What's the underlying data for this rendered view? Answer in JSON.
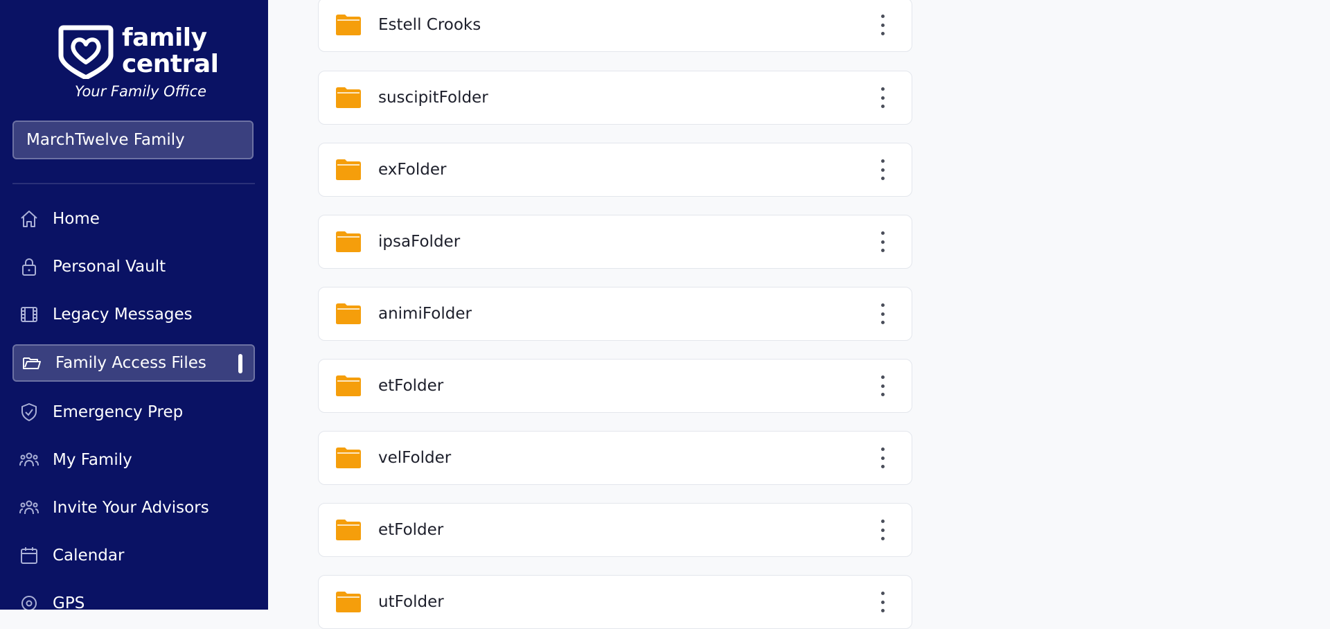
{
  "brand": {
    "name_line1": "family",
    "name_line2": "central",
    "tagline": "Your Family Office"
  },
  "family_selector": {
    "value": "MarchTwelve Family"
  },
  "sidebar": {
    "items": [
      {
        "label": "Home",
        "icon": "home-icon",
        "active": false
      },
      {
        "label": "Personal Vault",
        "icon": "lock-icon",
        "active": false
      },
      {
        "label": "Legacy Messages",
        "icon": "film-icon",
        "active": false
      },
      {
        "label": "Family Access Files",
        "icon": "folder-open-icon",
        "active": true
      },
      {
        "label": "Emergency Prep",
        "icon": "shield-check-icon",
        "active": false
      },
      {
        "label": "My Family",
        "icon": "people-icon",
        "active": false
      },
      {
        "label": "Invite Your Advisors",
        "icon": "people-icon",
        "active": false
      },
      {
        "label": "Calendar",
        "icon": "calendar-icon",
        "active": false
      },
      {
        "label": "GPS",
        "icon": "location-icon",
        "active": false
      }
    ]
  },
  "folders": [
    {
      "name": "Estell Crooks"
    },
    {
      "name": "suscipitFolder"
    },
    {
      "name": "exFolder"
    },
    {
      "name": "ipsaFolder"
    },
    {
      "name": "animiFolder"
    },
    {
      "name": "etFolder"
    },
    {
      "name": "velFolder"
    },
    {
      "name": "etFolder"
    },
    {
      "name": "utFolder"
    }
  ],
  "colors": {
    "sidebar_bg": "#0a1264",
    "active_bg": "#3a407f",
    "folder_color": "#f59e0b",
    "page_bg": "#f8f9fb"
  }
}
